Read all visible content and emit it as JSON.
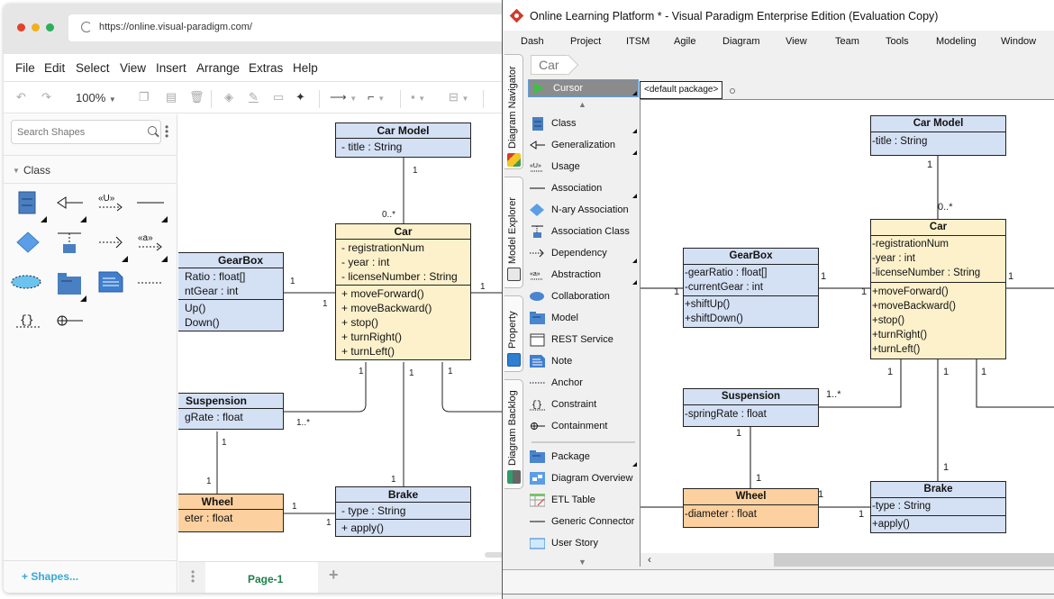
{
  "browser": {
    "url": "https://online.visual-paradigm.com/",
    "menu": [
      "File",
      "Edit",
      "Select",
      "View",
      "Insert",
      "Arrange",
      "Extras",
      "Help"
    ],
    "toolbar": {
      "zoom": "100%",
      "icons": [
        "undo-icon",
        "redo-icon",
        "copy-icon",
        "paste-icon",
        "delete-icon",
        "fill-color-icon",
        "line-color-icon",
        "shadow-icon",
        "format-painter-icon",
        "connector-icon",
        "waypoints-icon",
        "to-front-icon",
        "align-icon"
      ]
    },
    "sidebar": {
      "search_placeholder": "Search Shapes",
      "section": "Class",
      "shapes": [
        "class-shape",
        "generalization-shape",
        "usage-shape",
        "association-shape",
        "nary-association-shape",
        "association-class-shape",
        "dependency-shape",
        "abstraction-shape",
        "collaboration-shape",
        "package-shape",
        "note-shape",
        "anchor-shape",
        "constraint-shape",
        "containment-shape"
      ],
      "more_shapes": "+ Shapes..."
    },
    "pages": {
      "active": "Page-1",
      "add": "+"
    }
  },
  "left_diagram": {
    "classes": {
      "car_model": {
        "name": "Car Model",
        "attributes": [
          "- title : String"
        ],
        "operations": []
      },
      "car": {
        "name": "Car",
        "attributes": [
          "- registrationNum",
          "- year : int",
          "- licenseNumber : String"
        ],
        "operations": [
          "+ moveForward()",
          "+ moveBackward()",
          "+ stop()",
          "+ turnRight()",
          "+ turnLeft()"
        ]
      },
      "gearbox": {
        "name": "GearBox",
        "attributes": [
          "Ratio : float[]",
          "ntGear : int"
        ],
        "operations": [
          "Up()",
          "Down()"
        ]
      },
      "suspension": {
        "name": "Suspension",
        "attributes": [
          "gRate : float"
        ],
        "operations": []
      },
      "wheel": {
        "name": "Wheel",
        "attributes": [
          "eter : float"
        ],
        "operations": []
      },
      "brake": {
        "name": "Brake",
        "attributes": [
          "- type : String"
        ],
        "operations": [
          "+ apply()"
        ]
      }
    },
    "multiplicities": {
      "carmodel_car_top": "1",
      "carmodel_car_bottom": "0..*",
      "gearbox_car_left": "1",
      "gearbox_car_right": "1",
      "car_right": "1",
      "car_susp_top": "1",
      "susp_car": "1..*",
      "car_brake_top": "1",
      "car_brake_bottom": "1",
      "car_right_bottom": "1",
      "susp_wheel_top": "1",
      "susp_wheel_bottom": "1",
      "wheel_brake_left": "1",
      "wheel_brake_right": "1"
    }
  },
  "vp": {
    "title": "Online Learning Platform * - Visual Paradigm Enterprise Edition (Evaluation Copy)",
    "menu": [
      "Dash",
      "Project",
      "ITSM",
      "Agile",
      "Diagram",
      "View",
      "Team",
      "Tools",
      "Modeling",
      "Window"
    ],
    "side_tabs": [
      "Diagram Navigator",
      "Model Explorer",
      "Property",
      "Diagram Backlog"
    ],
    "breadcrumb": "Car",
    "package": "<default package>",
    "palette": {
      "cursor": "Cursor",
      "items": [
        {
          "label": "Class",
          "icon": "class-icon",
          "more": true
        },
        {
          "label": "Generalization",
          "icon": "generalization-icon",
          "more": true
        },
        {
          "label": "Usage",
          "icon": "usage-icon",
          "more": false
        },
        {
          "label": "Association",
          "icon": "association-icon",
          "more": true
        },
        {
          "label": "N-ary Association",
          "icon": "nary-association-icon",
          "more": false
        },
        {
          "label": "Association Class",
          "icon": "association-class-icon",
          "more": false
        },
        {
          "label": "Dependency",
          "icon": "dependency-icon",
          "more": true
        },
        {
          "label": "Abstraction",
          "icon": "abstraction-icon",
          "more": true
        },
        {
          "label": "Collaboration",
          "icon": "collaboration-icon",
          "more": false
        },
        {
          "label": "Model",
          "icon": "model-icon",
          "more": false
        },
        {
          "label": "REST Service",
          "icon": "rest-service-icon",
          "more": false
        },
        {
          "label": "Note",
          "icon": "note-icon",
          "more": false
        },
        {
          "label": "Anchor",
          "icon": "anchor-icon",
          "more": false
        },
        {
          "label": "Constraint",
          "icon": "constraint-icon",
          "more": false
        },
        {
          "label": "Containment",
          "icon": "containment-icon",
          "more": false
        },
        {
          "label": "Package",
          "icon": "package-icon",
          "more": true
        },
        {
          "label": "Diagram Overview",
          "icon": "diagram-overview-icon",
          "more": false
        },
        {
          "label": "ETL Table",
          "icon": "etl-table-icon",
          "more": false
        },
        {
          "label": "Generic Connector",
          "icon": "generic-connector-icon",
          "more": false
        },
        {
          "label": "User Story",
          "icon": "user-story-icon",
          "more": false
        }
      ]
    }
  },
  "right_diagram": {
    "classes": {
      "car_model": {
        "name": "Car Model",
        "attributes": [
          "-title : String"
        ],
        "operations": []
      },
      "car": {
        "name": "Car",
        "attributes": [
          "-registrationNum",
          "-year : int",
          "-licenseNumber : String"
        ],
        "operations": [
          "+moveForward()",
          "+moveBackward()",
          "+stop()",
          "+turnRight()",
          "+turnLeft()"
        ]
      },
      "gearbox": {
        "name": "GearBox",
        "attributes": [
          "-gearRatio : float[]",
          "-currentGear : int"
        ],
        "operations": [
          "+shiftUp()",
          "+shiftDown()"
        ]
      },
      "suspension": {
        "name": "Suspension",
        "attributes": [
          "-springRate : float"
        ],
        "operations": []
      },
      "wheel": {
        "name": "Wheel",
        "attributes": [
          "-diameter : float"
        ],
        "operations": []
      },
      "brake": {
        "name": "Brake",
        "attributes": [
          "-type : String"
        ],
        "operations": [
          "+apply()"
        ]
      }
    },
    "multiplicities": {
      "carmodel_car_top": "1",
      "carmodel_car_bottom": "0..*",
      "left_gearbox": "1",
      "gearbox_car_left": "1",
      "gearbox_car_right": "1",
      "car_right": "1",
      "car_susp_top": "1",
      "susp_car": "1..*",
      "car_brake_top": "1",
      "car_brake_bottom": "1",
      "car_right_bottom": "1",
      "susp_wheel_top": "1",
      "susp_wheel_bottom": "1",
      "wheel_brake_left": "1",
      "wheel_brake_right": "1"
    }
  },
  "colors": {
    "class_blue": "#d4e0f4",
    "class_yellow": "#fdf1cb",
    "class_orange": "#fcd09f",
    "page_tab_green": "#1e7e4a",
    "shapes_link_blue": "#38a8d8",
    "vp_logo_red": "#d03a2e"
  }
}
